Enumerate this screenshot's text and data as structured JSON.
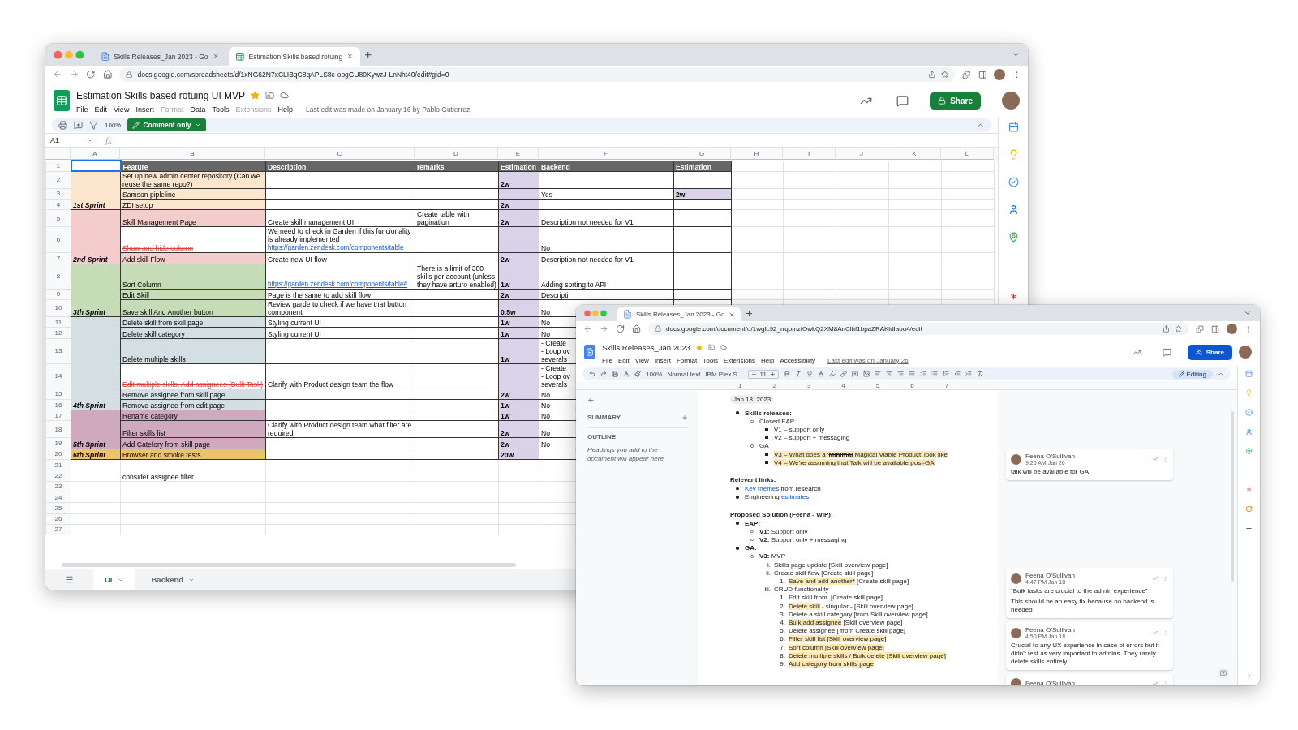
{
  "spreadsheet_window": {
    "tabs": [
      {
        "title": "Skills Releases_Jan 2023 - Go",
        "selected": false,
        "kind": "doc"
      },
      {
        "title": "Estimation Skills based rotuing",
        "selected": true,
        "kind": "sheet"
      }
    ],
    "url": "docs.google.com/spreadsheets/d/1xNG62N7xCLIBqC8qAPLS8c-opgGU80KywzJ-LnNht40/edit#gid=0",
    "title": "Estimation Skills based rotuing UI MVP",
    "starred": true,
    "menu": [
      {
        "label": "File",
        "disabled": false
      },
      {
        "label": "Edit",
        "disabled": false
      },
      {
        "label": "View",
        "disabled": false
      },
      {
        "label": "Insert",
        "disabled": false
      },
      {
        "label": "Format",
        "disabled": true
      },
      {
        "label": "Data",
        "disabled": false
      },
      {
        "label": "Tools",
        "disabled": false
      },
      {
        "label": "Extensions",
        "disabled": true
      },
      {
        "label": "Help",
        "disabled": false
      }
    ],
    "last_edit": "Last edit was made on January 16 by Pablo Gutierrez",
    "share": "Share",
    "zoom": "100%",
    "mode": "Comment only",
    "cell_ref": "A1",
    "fx": "fx",
    "columns": [
      "A",
      "B",
      "C",
      "D",
      "E",
      "F",
      "G",
      "H",
      "I",
      "J",
      "K",
      "L"
    ],
    "header": {
      "number": "1",
      "labels": [
        "Feature",
        "Description",
        "remarks",
        "Estimation",
        "Backend",
        "Estimation"
      ]
    },
    "groups": [
      {
        "sprint": "1st Sprint",
        "color": "#fce5cd",
        "rows": [
          {
            "number": "2",
            "feature": "Set up new admin center repository (Can we reuse the same repo?)",
            "struck": false,
            "estimation": "2w"
          },
          {
            "number": "3",
            "feature": "Samson pipleline",
            "struck": false,
            "backend": "Yes",
            "backend_estimation": "2w"
          },
          {
            "number": "4",
            "feature": "ZDI setup",
            "struck": false,
            "estimation": "2w"
          }
        ]
      },
      {
        "sprint": "2nd Sprint",
        "color": "#f4cccc",
        "rows": [
          {
            "number": "5",
            "feature": "Skill Management Page",
            "struck": false,
            "description": "Create skill management UI",
            "remarks": "Create table with pagination",
            "estimation": "2w",
            "backend": "Description not needed for V1"
          },
          {
            "number": "6",
            "feature": "Show and hide column",
            "struck": true,
            "description": "We need to check in Garden if this funcionality is already implemented",
            "description_link": "https://garden.zendesk.com/components/table",
            "backend": "No"
          },
          {
            "number": "7",
            "feature": "Add skill Flow",
            "struck": false,
            "description": "Create new UI flow",
            "estimation": "2w",
            "backend": "Description not needed for V1"
          }
        ]
      },
      {
        "sprint": "3th Sprint",
        "color": "#c5dcb6",
        "rows": [
          {
            "number": "8",
            "feature": "Sort Column",
            "struck": false,
            "description_link": "https://garden.zendesk.com/components/table#",
            "remarks": "There is a limit of 300 skills per account (unless they have arturo enabled)",
            "estimation": "1w",
            "backend": "Adding sorting to API"
          },
          {
            "number": "9",
            "feature": "Edit Skill",
            "struck": false,
            "description": "Page is the same to add skill flow",
            "estimation": "2w",
            "backend": "Descripti"
          },
          {
            "number": "10",
            "feature": "Save skill And Another button",
            "struck": false,
            "description": "Review garde to check if we have that button component",
            "estimation": "0.5w",
            "backend": "No"
          }
        ]
      },
      {
        "sprint": "4th Sprint",
        "color": "#d3dfe3",
        "rows": [
          {
            "number": "11",
            "feature": "Delete skill from skill page",
            "struck": false,
            "description": "Styling current UI",
            "estimation": "1w",
            "backend": "No"
          },
          {
            "number": "12",
            "feature": "Delete skill category",
            "struck": false,
            "description": "Styling current UI",
            "estimation": "1w",
            "backend": "No"
          },
          {
            "number": "13",
            "feature": "Delete multiple skills",
            "struck": false,
            "estimation": "1w",
            "backend": "- Create l\n- Loop ov\nseverals"
          },
          {
            "number": "14",
            "feature": "Edit multiple skills, Add assignees (Bulk Task)",
            "struck": true,
            "description": "Clarify with Product design team the flow",
            "backend": "- Create l\n- Loop ov\nseverals"
          },
          {
            "number": "15",
            "feature": "Remove assignee from skill page",
            "struck": false,
            "estimation": "2w",
            "backend": "No"
          },
          {
            "number": "16",
            "feature": "Remove assignee from edit page",
            "struck": false,
            "estimation": "1w",
            "backend": "No"
          }
        ]
      },
      {
        "sprint": "5th Sprint",
        "color": "#cfa9bd",
        "rows": [
          {
            "number": "17",
            "feature": "Rename category",
            "struck": false,
            "estimation": "1w",
            "backend": "No"
          },
          {
            "number": "18",
            "feature": "Filter skills list",
            "struck": false,
            "description": "Clarify with Product design team what filter are required",
            "estimation": "2w",
            "backend": "No"
          },
          {
            "number": "19",
            "feature": "Add Catefory from skill page",
            "struck": false,
            "estimation": "2w",
            "backend": "No"
          }
        ]
      },
      {
        "sprint": "6th Sprint",
        "color": "#e9c46a",
        "rows": [
          {
            "number": "20",
            "feature": "Browser and smoke tests",
            "struck": false,
            "estimation": "20w"
          }
        ]
      }
    ],
    "extra_rows": [
      {
        "number": "21"
      },
      {
        "number": "22",
        "feature": "consider assignee filter"
      },
      {
        "number": "23"
      },
      {
        "number": "24"
      },
      {
        "number": "25"
      },
      {
        "number": "26"
      },
      {
        "number": "27"
      }
    ],
    "sheets": [
      {
        "label": "UI",
        "selected": true
      },
      {
        "label": "Backend",
        "selected": false
      }
    ]
  },
  "document_window": {
    "tabs": [
      {
        "title": "Skills Releases_Jan 2023 - Go",
        "selected": true,
        "kind": "doc"
      }
    ],
    "url": "docs.google.com/document/d/1wglL92_rrqomztOwkQ2XM8AnClhf1bpaZRAKldIaou4/edit",
    "title": "Skills Releases_Jan 2023",
    "starred": true,
    "menu": [
      "File",
      "Edit",
      "View",
      "Insert",
      "Format",
      "Tools",
      "Extensions",
      "Help",
      "Accessibility"
    ],
    "last_edit": "Last edit was on January 26",
    "share": "Share",
    "toolbar": {
      "zoom": "100%",
      "style": "Normal text",
      "font": "IBM Plex S...",
      "font_size": "11",
      "mode": "Editing"
    },
    "ruler": [
      "1",
      "2",
      "3",
      "4",
      "5",
      "6",
      "7"
    ],
    "outline": {
      "summary": "SUMMARY",
      "outline": "OUTLINE",
      "hint": "Headings you add to the document will appear here."
    },
    "body": [
      {
        "kind": "date",
        "text": "Jan 18, 2023"
      },
      {
        "kind": "list",
        "items": [
          {
            "segments": [
              {
                "text": "Skills releases:",
                "kind": "bold"
              }
            ],
            "children": [
              {
                "segments": [
                  {
                    "text": "Closed EAP",
                    "kind": "plain"
                  }
                ],
                "children": [
                  {
                    "segments": [
                      {
                        "text": "V1 – support only",
                        "kind": "plain"
                      }
                    ]
                  },
                  {
                    "segments": [
                      {
                        "text": "V2 – support + messaging",
                        "kind": "plain"
                      }
                    ]
                  }
                ]
              },
              {
                "segments": [
                  {
                    "text": "GA",
                    "kind": "plain"
                  }
                ],
                "children": [
                  {
                    "segments": [
                      {
                        "text": "V3 – What does a ‘",
                        "kind": "highlight"
                      },
                      {
                        "text": "Minimal",
                        "kind": "struck"
                      },
                      {
                        "text": " Magical Viable Product’ look like",
                        "kind": "highlight"
                      }
                    ]
                  },
                  {
                    "segments": [
                      {
                        "text": "V4 – We’re assuming that Talk will be available post-GA",
                        "kind": "highlight"
                      }
                    ]
                  }
                ]
              }
            ]
          }
        ]
      },
      {
        "kind": "heading",
        "text": "Relevant links:"
      },
      {
        "kind": "list",
        "items": [
          {
            "segments": [
              {
                "text": "Key themes",
                "kind": "link"
              },
              {
                "text": " from research",
                "kind": "plain"
              }
            ]
          },
          {
            "segments": [
              {
                "text": "Engineering ",
                "kind": "plain"
              },
              {
                "text": "estimates",
                "kind": "link"
              }
            ]
          }
        ]
      },
      {
        "kind": "heading",
        "text": "Proposed Solution (Feena - WIP):"
      },
      {
        "kind": "list",
        "items": [
          {
            "segments": [
              {
                "text": "EAP:",
                "kind": "bold"
              }
            ],
            "children": [
              {
                "segments": [
                  {
                    "text": "V1:",
                    "kind": "bold"
                  },
                  {
                    "text": " Support only",
                    "kind": "plain"
                  }
                ]
              },
              {
                "segments": [
                  {
                    "text": "V2:",
                    "kind": "bold"
                  },
                  {
                    "text": " Support only + messaging",
                    "kind": "plain"
                  }
                ]
              }
            ]
          },
          {
            "segments": [
              {
                "text": "GA:",
                "kind": "bold"
              }
            ],
            "children": [
              {
                "segments": [
                  {
                    "text": "V3:",
                    "kind": "bold"
                  },
                  {
                    "text": " MVP",
                    "kind": "plain"
                  }
                ],
                "children": [
                  {
                    "marker": "i.",
                    "segments": [
                      {
                        "text": "Skills page update [Skill overview page]",
                        "kind": "plain"
                      }
                    ]
                  },
                  {
                    "marker": "ii.",
                    "segments": [
                      {
                        "text": "Create skill flow [Create skill page]",
                        "kind": "plain"
                      }
                    ],
                    "children": [
                      {
                        "marker": "1.",
                        "segments": [
                          {
                            "text": "Save and add another*",
                            "kind": "highlight"
                          },
                          {
                            "text": " [Create skill page]",
                            "kind": "plain"
                          }
                        ]
                      }
                    ]
                  },
                  {
                    "marker": "iii.",
                    "segments": [
                      {
                        "text": "CRUD functionality",
                        "kind": "plain"
                      }
                    ],
                    "children": [
                      {
                        "marker": "1.",
                        "segments": [
                          {
                            "text": "Edit skill from  [Create skill page]",
                            "kind": "plain"
                          }
                        ]
                      },
                      {
                        "marker": "2.",
                        "segments": [
                          {
                            "text": "Delete skill",
                            "kind": "highlight"
                          },
                          {
                            "text": " - singular - [Skill overview page]",
                            "kind": "plain"
                          }
                        ]
                      },
                      {
                        "marker": "3.",
                        "segments": [
                          {
                            "text": "Delete a skill category [from Skill overview page]",
                            "kind": "plain"
                          }
                        ]
                      },
                      {
                        "marker": "4.",
                        "segments": [
                          {
                            "text": "Bulk add assignee",
                            "kind": "highlight"
                          },
                          {
                            "text": " [Skill overview page]",
                            "kind": "plain"
                          }
                        ]
                      },
                      {
                        "marker": "5.",
                        "segments": [
                          {
                            "text": "Delete assignee [ from Create skill page]",
                            "kind": "plain"
                          }
                        ]
                      },
                      {
                        "marker": "6.",
                        "segments": [
                          {
                            "text": "Filter skill list [Skill overview page]",
                            "kind": "highlight"
                          }
                        ]
                      },
                      {
                        "marker": "7.",
                        "segments": [
                          {
                            "text": "Sort column [Skill overview page]",
                            "kind": "highlight"
                          }
                        ]
                      },
                      {
                        "marker": "8.",
                        "segments": [
                          {
                            "text": "Delete multiple skills / Bulk delete [Skill overview page]",
                            "kind": "highlight"
                          }
                        ]
                      },
                      {
                        "marker": "9.",
                        "segments": [
                          {
                            "text": "Add category from skills page",
                            "kind": "highlight"
                          }
                        ]
                      }
                    ]
                  }
                ]
              }
            ]
          }
        ]
      }
    ],
    "comments": [
      {
        "author": "Feena O’Sullivan",
        "time": "9:20 AM Jan 26",
        "lines": [
          "talk will be available for GA"
        ]
      },
      {
        "author": "Feena O’Sullivan",
        "time": "4:47 PM Jan 18",
        "lines": [
          "“Bulk tasks are crucial to the admin experience”",
          "This should be an easy fix because no backend is needed"
        ]
      },
      {
        "author": "Feena O’Sullivan",
        "time": "4:50 PM Jan 18",
        "lines": [
          "Crucial to any UX experience in case of errors but it didn't test as very important to admins. They rarely delete skills entirely"
        ]
      },
      {
        "author": "Feena O’Sullivan"
      }
    ]
  }
}
